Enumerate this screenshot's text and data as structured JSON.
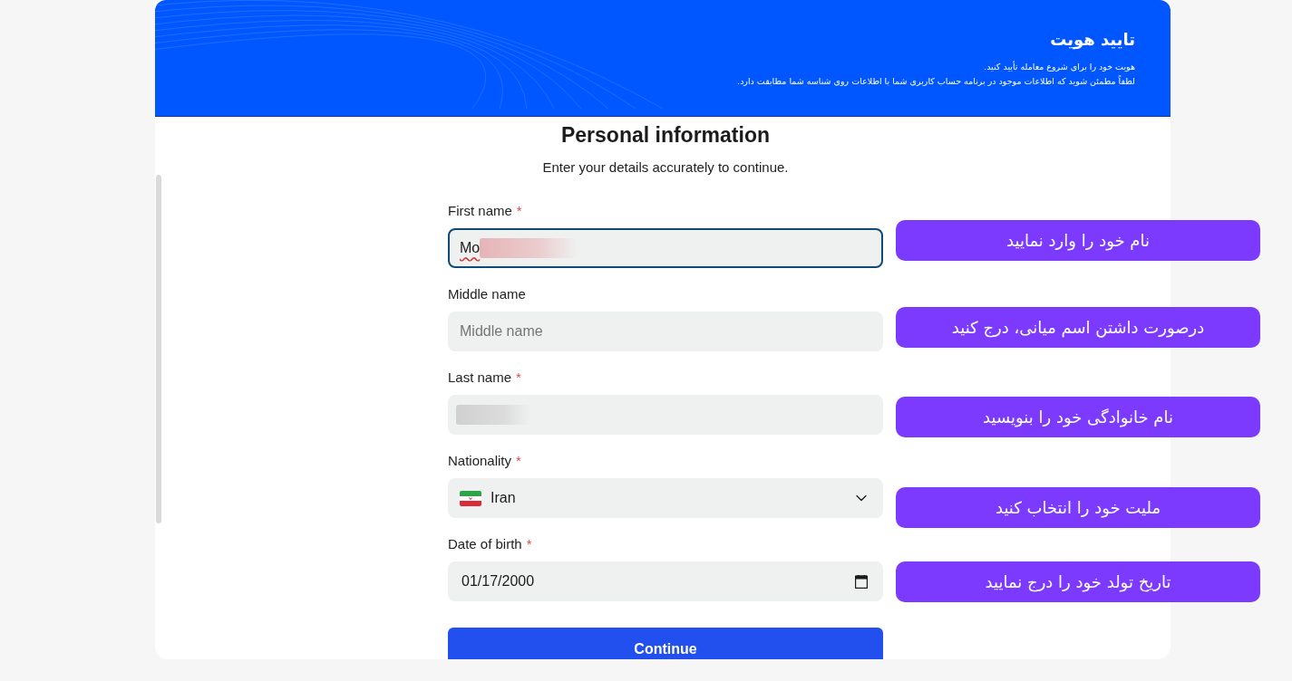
{
  "header": {
    "title": "تایید هویت",
    "lines": [
      "هویت خود را برای شروع معامله تأیید کنید.",
      "لطفاً مطمئن شوید که اطلاعات موجود در برنامه حساب کاربری شما با اطلاعات روی شناسه شما مطابقت دارد."
    ]
  },
  "form": {
    "title": "Personal information",
    "subtitle": "Enter your details accurately to continue.",
    "fields": [
      {
        "kind": "text",
        "label": "First name",
        "required_mark": "*",
        "value": "Mo",
        "redacted": true,
        "focused": true,
        "spell_error": true
      },
      {
        "kind": "text",
        "label": "Middle name",
        "placeholder": "Middle name",
        "focused": false
      },
      {
        "kind": "text",
        "label": "Last name",
        "required_mark": "*",
        "redacted": true,
        "focused": false
      },
      {
        "kind": "select",
        "label": "Nationality",
        "required_mark": "*",
        "value": "Iran",
        "focused": false
      },
      {
        "kind": "date",
        "label": "Date of birth",
        "required_mark": "*",
        "value": "01/17/2000",
        "focused": false
      }
    ],
    "submit": "Continue"
  },
  "annotations": [
    {
      "text": "نام خود را وارد نمایید"
    },
    {
      "text": "درصورت داشتن اسم میانی، درج کنید"
    },
    {
      "text": "نام خانوادگی خود را بنویسید"
    },
    {
      "text": "ملیت خود را انتخاب کنید"
    },
    {
      "text": "تاریخ تولد خود را درج نمایید"
    }
  ]
}
